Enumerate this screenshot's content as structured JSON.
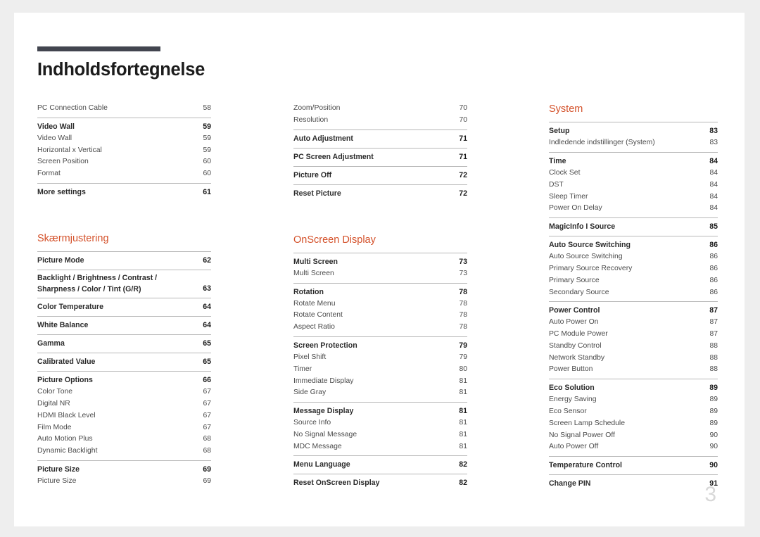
{
  "document": {
    "title": "Indholdsfortegnelse",
    "page_number": "3",
    "accent_color": "#d4512a",
    "rule_color": "#42454f"
  },
  "columns": [
    {
      "id": "column-1",
      "blocks": [
        {
          "type": "group",
          "rule": false,
          "rows": [
            {
              "label": "PC Connection Cable",
              "page": "58",
              "bold": false
            }
          ]
        },
        {
          "type": "group",
          "rule": true,
          "rows": [
            {
              "label": "Video Wall",
              "page": "59",
              "bold": true
            },
            {
              "label": "Video Wall",
              "page": "59",
              "bold": false
            },
            {
              "label": "Horizontal x Vertical",
              "page": "59",
              "bold": false
            },
            {
              "label": "Screen Position",
              "page": "60",
              "bold": false
            },
            {
              "label": "Format",
              "page": "60",
              "bold": false
            }
          ]
        },
        {
          "type": "group",
          "rule": true,
          "rows": [
            {
              "label": "More settings",
              "page": "61",
              "bold": true
            }
          ]
        },
        {
          "type": "spacer",
          "size": "lg"
        },
        {
          "type": "heading",
          "label": "Skærmjustering"
        },
        {
          "type": "group",
          "rule": true,
          "rows": [
            {
              "label": "Picture Mode",
              "page": "62",
              "bold": true
            }
          ]
        },
        {
          "type": "group",
          "rule": true,
          "rows": [
            {
              "label": "Backlight / Brightness / Contrast / Sharpness / Color / Tint (G/R)",
              "page": "63",
              "bold": true,
              "twoline": true
            }
          ]
        },
        {
          "type": "group",
          "rule": true,
          "rows": [
            {
              "label": "Color Temperature",
              "page": "64",
              "bold": true
            }
          ]
        },
        {
          "type": "group",
          "rule": true,
          "rows": [
            {
              "label": "White Balance",
              "page": "64",
              "bold": true
            }
          ]
        },
        {
          "type": "group",
          "rule": true,
          "rows": [
            {
              "label": "Gamma",
              "page": "65",
              "bold": true
            }
          ]
        },
        {
          "type": "group",
          "rule": true,
          "rows": [
            {
              "label": "Calibrated Value",
              "page": "65",
              "bold": true
            }
          ]
        },
        {
          "type": "group",
          "rule": true,
          "rows": [
            {
              "label": "Picture Options",
              "page": "66",
              "bold": true
            },
            {
              "label": "Color Tone",
              "page": "67",
              "bold": false
            },
            {
              "label": "Digital NR",
              "page": "67",
              "bold": false
            },
            {
              "label": "HDMI Black Level",
              "page": "67",
              "bold": false
            },
            {
              "label": "Film Mode",
              "page": "67",
              "bold": false
            },
            {
              "label": "Auto Motion Plus",
              "page": "68",
              "bold": false
            },
            {
              "label": "Dynamic Backlight",
              "page": "68",
              "bold": false
            }
          ]
        },
        {
          "type": "group",
          "rule": true,
          "rows": [
            {
              "label": "Picture Size",
              "page": "69",
              "bold": true
            },
            {
              "label": "Picture Size",
              "page": "69",
              "bold": false
            }
          ]
        }
      ]
    },
    {
      "id": "column-2",
      "blocks": [
        {
          "type": "group",
          "rule": false,
          "rows": [
            {
              "label": "Zoom/Position",
              "page": "70",
              "bold": false
            },
            {
              "label": "Resolution",
              "page": "70",
              "bold": false
            }
          ]
        },
        {
          "type": "group",
          "rule": true,
          "rows": [
            {
              "label": "Auto Adjustment",
              "page": "71",
              "bold": true
            }
          ]
        },
        {
          "type": "group",
          "rule": true,
          "rows": [
            {
              "label": "PC Screen Adjustment",
              "page": "71",
              "bold": true
            }
          ]
        },
        {
          "type": "group",
          "rule": true,
          "rows": [
            {
              "label": "Picture Off",
              "page": "72",
              "bold": true
            }
          ]
        },
        {
          "type": "group",
          "rule": true,
          "rows": [
            {
              "label": "Reset Picture",
              "page": "72",
              "bold": true
            }
          ]
        },
        {
          "type": "spacer",
          "size": "lg"
        },
        {
          "type": "heading",
          "label": "OnScreen Display"
        },
        {
          "type": "group",
          "rule": true,
          "rows": [
            {
              "label": "Multi Screen",
              "page": "73",
              "bold": true
            },
            {
              "label": "Multi Screen",
              "page": "73",
              "bold": false
            }
          ]
        },
        {
          "type": "group",
          "rule": true,
          "rows": [
            {
              "label": "Rotation",
              "page": "78",
              "bold": true
            },
            {
              "label": "Rotate Menu",
              "page": "78",
              "bold": false
            },
            {
              "label": "Rotate Content",
              "page": "78",
              "bold": false
            },
            {
              "label": "Aspect Ratio",
              "page": "78",
              "bold": false
            }
          ]
        },
        {
          "type": "group",
          "rule": true,
          "rows": [
            {
              "label": "Screen Protection",
              "page": "79",
              "bold": true
            },
            {
              "label": "Pixel Shift",
              "page": "79",
              "bold": false
            },
            {
              "label": "Timer",
              "page": "80",
              "bold": false
            },
            {
              "label": "Immediate Display",
              "page": "81",
              "bold": false
            },
            {
              "label": "Side Gray",
              "page": "81",
              "bold": false
            }
          ]
        },
        {
          "type": "group",
          "rule": true,
          "rows": [
            {
              "label": "Message Display",
              "page": "81",
              "bold": true
            },
            {
              "label": "Source Info",
              "page": "81",
              "bold": false
            },
            {
              "label": "No Signal Message",
              "page": "81",
              "bold": false
            },
            {
              "label": "MDC Message",
              "page": "81",
              "bold": false
            }
          ]
        },
        {
          "type": "group",
          "rule": true,
          "rows": [
            {
              "label": "Menu Language",
              "page": "82",
              "bold": true
            }
          ]
        },
        {
          "type": "group",
          "rule": true,
          "rows": [
            {
              "label": "Reset OnScreen Display",
              "page": "82",
              "bold": true
            }
          ]
        }
      ]
    },
    {
      "id": "column-3",
      "blocks": [
        {
          "type": "heading",
          "label": "System"
        },
        {
          "type": "group",
          "rule": true,
          "rows": [
            {
              "label": "Setup",
              "page": "83",
              "bold": true
            },
            {
              "label": "Indledende indstillinger (System)",
              "page": "83",
              "bold": false
            }
          ]
        },
        {
          "type": "group",
          "rule": true,
          "rows": [
            {
              "label": "Time",
              "page": "84",
              "bold": true
            },
            {
              "label": "Clock Set",
              "page": "84",
              "bold": false
            },
            {
              "label": "DST",
              "page": "84",
              "bold": false
            },
            {
              "label": "Sleep Timer",
              "page": "84",
              "bold": false
            },
            {
              "label": "Power On Delay",
              "page": "84",
              "bold": false
            }
          ]
        },
        {
          "type": "group",
          "rule": true,
          "rows": [
            {
              "label": "MagicInfo I Source",
              "page": "85",
              "bold": true
            }
          ]
        },
        {
          "type": "group",
          "rule": true,
          "rows": [
            {
              "label": "Auto Source Switching",
              "page": "86",
              "bold": true
            },
            {
              "label": "Auto Source Switching",
              "page": "86",
              "bold": false
            },
            {
              "label": "Primary Source Recovery",
              "page": "86",
              "bold": false
            },
            {
              "label": "Primary Source",
              "page": "86",
              "bold": false
            },
            {
              "label": "Secondary Source",
              "page": "86",
              "bold": false
            }
          ]
        },
        {
          "type": "group",
          "rule": true,
          "rows": [
            {
              "label": "Power Control",
              "page": "87",
              "bold": true
            },
            {
              "label": "Auto Power On",
              "page": "87",
              "bold": false
            },
            {
              "label": "PC Module Power",
              "page": "87",
              "bold": false
            },
            {
              "label": "Standby Control",
              "page": "88",
              "bold": false
            },
            {
              "label": "Network Standby",
              "page": "88",
              "bold": false
            },
            {
              "label": "Power Button",
              "page": "88",
              "bold": false
            }
          ]
        },
        {
          "type": "group",
          "rule": true,
          "rows": [
            {
              "label": "Eco Solution",
              "page": "89",
              "bold": true
            },
            {
              "label": "Energy Saving",
              "page": "89",
              "bold": false
            },
            {
              "label": "Eco Sensor",
              "page": "89",
              "bold": false
            },
            {
              "label": "Screen Lamp Schedule",
              "page": "89",
              "bold": false
            },
            {
              "label": "No Signal Power Off",
              "page": "90",
              "bold": false
            },
            {
              "label": "Auto Power Off",
              "page": "90",
              "bold": false
            }
          ]
        },
        {
          "type": "group",
          "rule": true,
          "rows": [
            {
              "label": "Temperature Control",
              "page": "90",
              "bold": true
            }
          ]
        },
        {
          "type": "group",
          "rule": true,
          "rows": [
            {
              "label": "Change PIN",
              "page": "91",
              "bold": true
            }
          ]
        }
      ]
    }
  ]
}
